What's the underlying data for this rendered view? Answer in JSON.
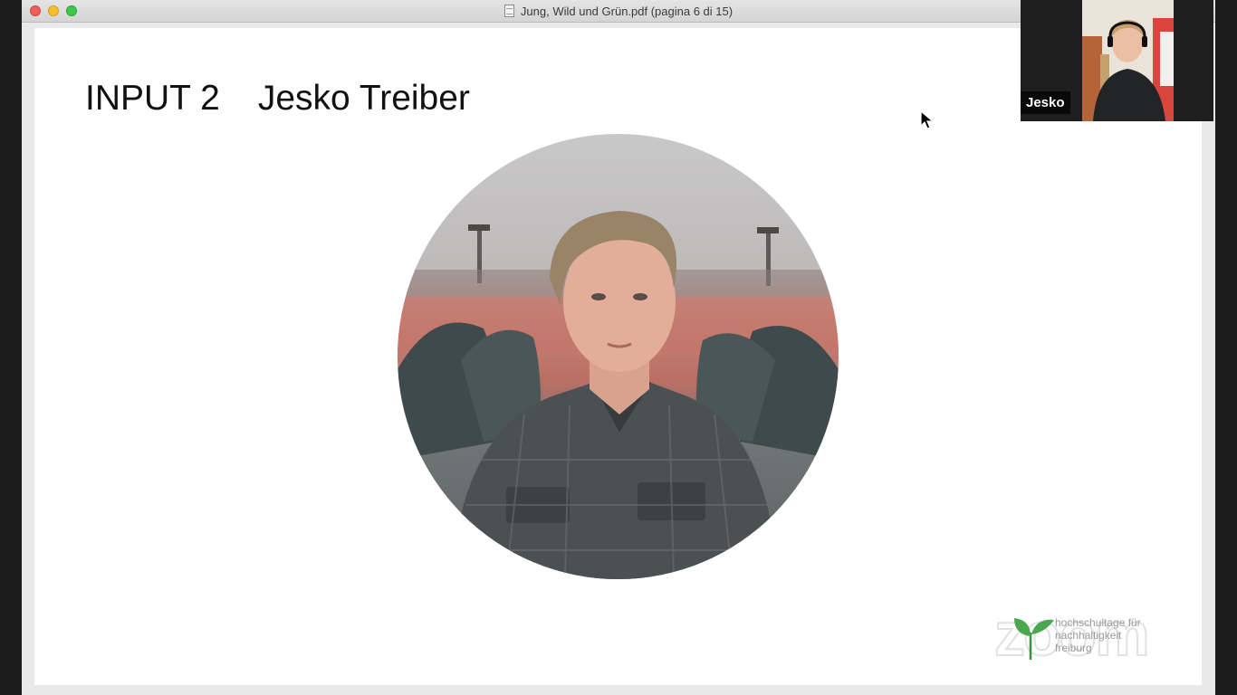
{
  "window": {
    "title": "Jung, Wild und Grün.pdf (pagina 6 di 15)"
  },
  "slide": {
    "title_left": "INPUT 2",
    "title_right": "Jesko Treiber"
  },
  "logo": {
    "lines": [
      "hochschultage für",
      "nachhaltigkeit",
      "freiburg"
    ],
    "overlay_word": "zoom"
  },
  "participant": {
    "name": "Jesko"
  },
  "colors": {
    "close": "#ee5f57",
    "minimize": "#f6bd2f",
    "maximize": "#3fc74a",
    "logo_leaf": "#4aa84f"
  }
}
